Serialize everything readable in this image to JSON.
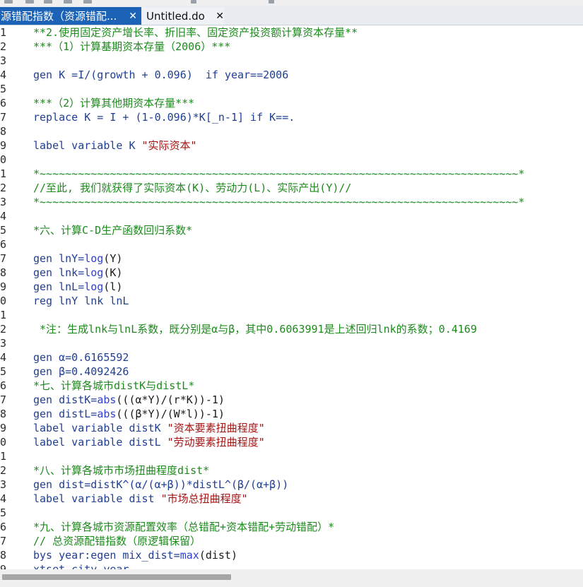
{
  "tabs": [
    {
      "label": "源错配指数（资源错配...",
      "close": "✕"
    },
    {
      "label": "Untitled.do",
      "close": "✕"
    }
  ],
  "toolbar": {
    "icons": [
      "save-icon",
      "print-icon",
      "find-icon",
      "copy-icon",
      "paste-icon",
      "bookmark-icon",
      "run-icon"
    ]
  },
  "editor": {
    "lines": [
      {
        "num": "1",
        "parts": [
          {
            "t": "**2.使用固定资产增长率、折旧率、固定资产投资额计算资本存量**",
            "c": "cmt"
          }
        ]
      },
      {
        "num": "2",
        "parts": [
          {
            "t": "***（1）计算基期资本存量（2006）***",
            "c": "cmt"
          }
        ]
      },
      {
        "num": "3",
        "parts": []
      },
      {
        "num": "4",
        "parts": [
          {
            "t": "gen K =I/(growth + 0.096)  ",
            "c": "kw"
          },
          {
            "t": "if year==2006",
            "c": "kw"
          }
        ]
      },
      {
        "num": "5",
        "parts": []
      },
      {
        "num": "6",
        "parts": [
          {
            "t": "***（2）计算其他期资本存量***",
            "c": "cmt"
          }
        ]
      },
      {
        "num": "7",
        "parts": [
          {
            "t": "replace K = I + (1-0.096)*K[_n-1] if K==.",
            "c": "kw"
          }
        ]
      },
      {
        "num": "8",
        "parts": []
      },
      {
        "num": "9",
        "parts": [
          {
            "t": "label variable K ",
            "c": "kw"
          },
          {
            "t": "\"实际资本\"",
            "c": "str"
          }
        ]
      },
      {
        "num": "0",
        "parts": []
      },
      {
        "num": "1",
        "parts": [
          {
            "t": "*~~~~~~~~~~~~~~~~~~~~~~~~~~~~~~~~~~~~~~~~~~~~~~~~~~~~~~~~~~~~~~~~~~~~~~~~~~~*",
            "c": "cmt"
          }
        ]
      },
      {
        "num": "2",
        "parts": [
          {
            "t": "//至此, 我们就获得了实际资本(K)、劳动力(L)、实际产出(Y)//",
            "c": "cmt"
          }
        ]
      },
      {
        "num": "3",
        "parts": [
          {
            "t": "*~~~~~~~~~~~~~~~~~~~~~~~~~~~~~~~~~~~~~~~~~~~~~~~~~~~~~~~~~~~~~~~~~~~~~~~~~~~*",
            "c": "cmt"
          }
        ]
      },
      {
        "num": "4",
        "parts": []
      },
      {
        "num": "5",
        "parts": [
          {
            "t": "*六、计算C-D生产函数回归系数*",
            "c": "cmt"
          }
        ]
      },
      {
        "num": "6",
        "parts": []
      },
      {
        "num": "7",
        "parts": [
          {
            "t": "gen lnY=",
            "c": "kw"
          },
          {
            "t": "log",
            "c": "fn"
          },
          {
            "t": "(Y)",
            "c": "tx"
          }
        ]
      },
      {
        "num": "8",
        "parts": [
          {
            "t": "gen lnk=",
            "c": "kw"
          },
          {
            "t": "log",
            "c": "fn"
          },
          {
            "t": "(K)",
            "c": "tx"
          }
        ]
      },
      {
        "num": "9",
        "parts": [
          {
            "t": "gen lnL=",
            "c": "kw"
          },
          {
            "t": "log",
            "c": "fn"
          },
          {
            "t": "(l)",
            "c": "tx"
          }
        ]
      },
      {
        "num": "0",
        "parts": [
          {
            "t": "reg lnY lnk lnL",
            "c": "kw"
          }
        ]
      },
      {
        "num": "1",
        "parts": []
      },
      {
        "num": "2",
        "parts": [
          {
            "t": " *注：生成lnk与lnL系数，既分别是α与β，其中0.6063991是上述回归lnk的系数；0.4169",
            "c": "cmt"
          }
        ]
      },
      {
        "num": "3",
        "parts": []
      },
      {
        "num": "4",
        "parts": [
          {
            "t": "gen α=0.6165592",
            "c": "kw"
          }
        ]
      },
      {
        "num": "5",
        "parts": [
          {
            "t": "gen β=0.4092426",
            "c": "kw"
          }
        ]
      },
      {
        "num": "6",
        "parts": [
          {
            "t": "*七、计算各城市distK与distL*",
            "c": "cmt"
          }
        ]
      },
      {
        "num": "7",
        "parts": [
          {
            "t": "gen distK=",
            "c": "kw"
          },
          {
            "t": "abs",
            "c": "fn"
          },
          {
            "t": "(((α*Y)/(r*K))-1)",
            "c": "tx"
          }
        ]
      },
      {
        "num": "8",
        "parts": [
          {
            "t": "gen distL=",
            "c": "kw"
          },
          {
            "t": "abs",
            "c": "fn"
          },
          {
            "t": "(((β*Y)/(W*l))-1)",
            "c": "tx"
          }
        ]
      },
      {
        "num": "9",
        "parts": [
          {
            "t": "label variable distK ",
            "c": "kw"
          },
          {
            "t": "\"资本要素扭曲程度\"",
            "c": "str"
          }
        ]
      },
      {
        "num": "0",
        "parts": [
          {
            "t": "label variable distL ",
            "c": "kw"
          },
          {
            "t": "\"劳动要素扭曲程度\"",
            "c": "str"
          }
        ]
      },
      {
        "num": "1",
        "parts": []
      },
      {
        "num": "2",
        "parts": [
          {
            "t": "*八、计算各城市市场扭曲程度dist*",
            "c": "cmt"
          }
        ]
      },
      {
        "num": "3",
        "parts": [
          {
            "t": "gen dist=distK^(α/(α+β))*distL^(β/(α+β))",
            "c": "kw"
          }
        ]
      },
      {
        "num": "4",
        "parts": [
          {
            "t": "label variable dist ",
            "c": "kw"
          },
          {
            "t": "\"市场总扭曲程度\"",
            "c": "str"
          }
        ]
      },
      {
        "num": "5",
        "parts": []
      },
      {
        "num": "6",
        "parts": [
          {
            "t": "*九、计算各城市资源配置效率（总错配+资本错配+劳动错配）*",
            "c": "cmt"
          }
        ]
      },
      {
        "num": "7",
        "parts": [
          {
            "t": "// 总资源配错指数（原逻辑保留）",
            "c": "cmt"
          }
        ]
      },
      {
        "num": "8",
        "parts": [
          {
            "t": "bys year:egen mix_dist=",
            "c": "kw"
          },
          {
            "t": "max",
            "c": "fn"
          },
          {
            "t": "(dist)",
            "c": "tx"
          }
        ]
      },
      {
        "num": "9",
        "parts": [
          {
            "t": "xtset city year",
            "c": "kw"
          }
        ]
      }
    ]
  }
}
